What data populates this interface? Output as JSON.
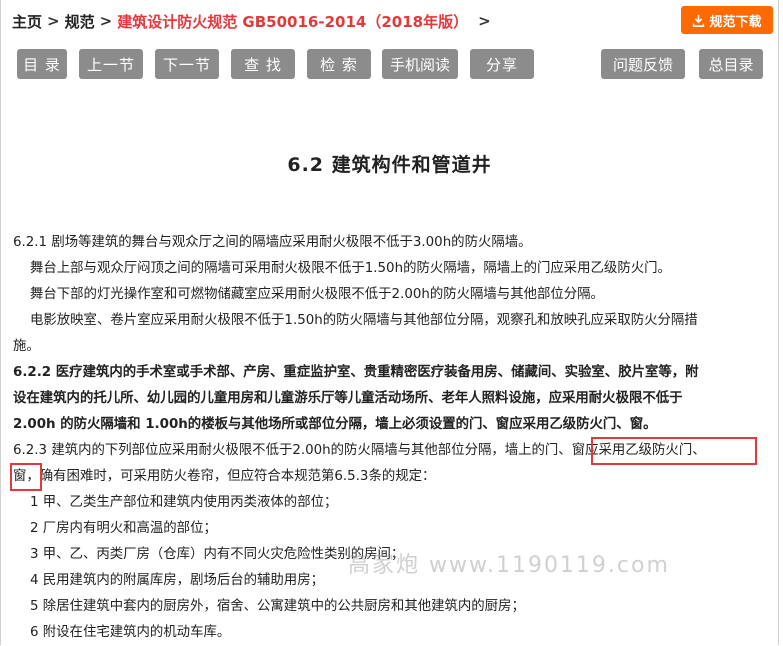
{
  "breadcrumb": {
    "home": "主页",
    "sep1": ">",
    "standards": "规范",
    "sep2": ">",
    "current": "建筑设计防火规范 GB50016-2014（2018年版）",
    "sep3": ">"
  },
  "download_button": {
    "label": "规范下载",
    "icon": "download-icon",
    "color": "#ff6a00"
  },
  "toolbar": {
    "toc": "目 录",
    "prev": "上一节",
    "next": "下一节",
    "find": "查 找",
    "search": "检 索",
    "mobile": "手机阅读",
    "share": "分享",
    "feedback": "问题反馈",
    "master_toc": "总目录"
  },
  "section_title": "6.2  建筑构件和管道井",
  "content": {
    "l1": "6.2.1 剧场等建筑的舞台与观众厅之间的隔墙应采用耐火极限不低于3.00h的防火隔墙。",
    "l2": "舞台上部与观众厅闷顶之间的隔墙可采用耐火极限不低于1.50h的防火隔墙，隔墙上的门应采用乙级防火门。",
    "l3": "舞台下部的灯光操作室和可燃物储藏室应采用耐火极限不低于2.00h的防火隔墙与其他部位分隔。",
    "l4": "电影放映室、卷片室应采用耐火极限不低于1.50h的防火隔墙与其他部位分隔，观察孔和放映孔应采取防火分隔措",
    "l5": "施。",
    "l6": "6.2.2 医疗建筑内的手术室或手术部、产房、重症监护室、贵重精密医疗装备用房、储藏间、实验室、胶片室等，附",
    "l7": "设在建筑内的托儿所、幼儿园的儿童用房和儿童游乐厅等儿童活动场所、老年人照料设施，应采用耐火极限不低于",
    "l8": "2.00h 的防火隔墙和 1.00h的楼板与其他场所或部位分隔，墙上必须设置的门、窗应采用乙级防火门、窗。",
    "l9": "6.2.3 建筑内的下列部位应采用耐火极限不低于2.00h的防火隔墙与其他部位分隔，墙上的门、窗应采用乙级防火门、",
    "l10": "窗，确有困难时，可采用防火卷帘，但应符合本规范第6.5.3条的规定：",
    "l11": "1 甲、乙类生产部位和建筑内使用丙类液体的部位；",
    "l12": "2 厂房内有明火和高温的部位；",
    "l13": "3 甲、乙、丙类厂房（仓库）内有不同火灾危险性类别的房间；",
    "l14": "4 民用建筑内的附属库房，剧场后台的辅助用房；",
    "l15": "5 除居住建筑中套内的厨房外，宿舍、公寓建筑中的公共厨房和其他建筑内的厨房；",
    "l16": "6 附设在住宅建筑内的机动车库。"
  },
  "watermark": "高家炮  www.1190119.com",
  "colors": {
    "accent_red": "#e4393c",
    "button_gray": "#8c8c8c"
  }
}
